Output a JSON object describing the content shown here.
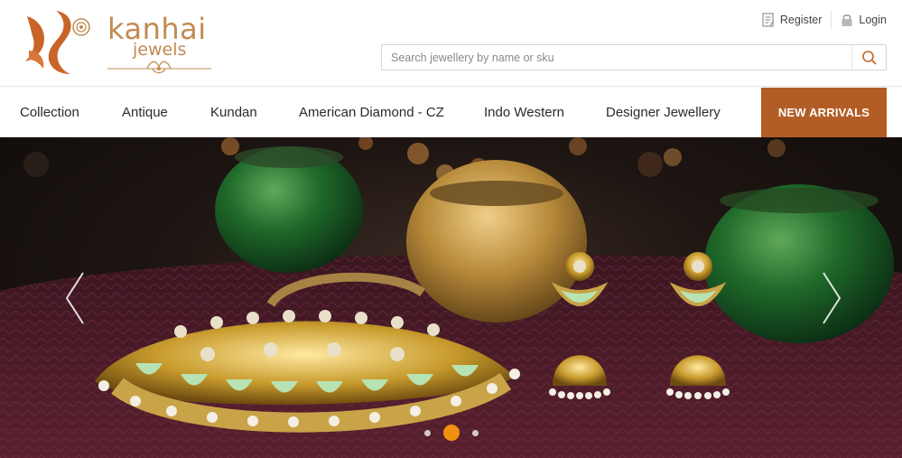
{
  "brand": {
    "name": "kanhai",
    "sub": "jewels",
    "mark_color": "#c8642a",
    "text_color": "#c28a52"
  },
  "top_links": {
    "register_label": "Register",
    "login_label": "Login"
  },
  "search": {
    "placeholder": "Search jewellery by name or sku",
    "value": ""
  },
  "nav": {
    "items": [
      {
        "label": "Collection"
      },
      {
        "label": "Antique"
      },
      {
        "label": "Kundan"
      },
      {
        "label": "American Diamond - CZ"
      },
      {
        "label": "Indo Western"
      },
      {
        "label": "Designer Jewellery"
      }
    ],
    "cta_label": "NEW ARRIVALS",
    "cta_color": "#b35d26"
  },
  "hero": {
    "slide_count": 3,
    "active_slide": 2,
    "dot_active_color": "#f2900f",
    "icons": {
      "prev": "chevron-left-icon",
      "next": "chevron-right-icon"
    }
  }
}
